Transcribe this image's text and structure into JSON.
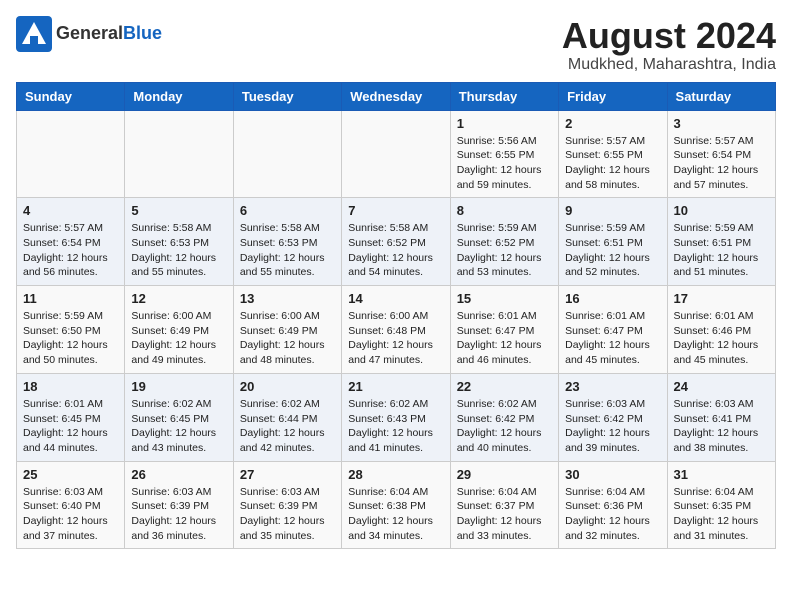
{
  "header": {
    "logo_general": "General",
    "logo_blue": "Blue",
    "month_year": "August 2024",
    "location": "Mudkhed, Maharashtra, India"
  },
  "weekdays": [
    "Sunday",
    "Monday",
    "Tuesday",
    "Wednesday",
    "Thursday",
    "Friday",
    "Saturday"
  ],
  "weeks": [
    [
      {
        "day": "",
        "content": ""
      },
      {
        "day": "",
        "content": ""
      },
      {
        "day": "",
        "content": ""
      },
      {
        "day": "",
        "content": ""
      },
      {
        "day": "1",
        "content": "Sunrise: 5:56 AM\nSunset: 6:55 PM\nDaylight: 12 hours\nand 59 minutes."
      },
      {
        "day": "2",
        "content": "Sunrise: 5:57 AM\nSunset: 6:55 PM\nDaylight: 12 hours\nand 58 minutes."
      },
      {
        "day": "3",
        "content": "Sunrise: 5:57 AM\nSunset: 6:54 PM\nDaylight: 12 hours\nand 57 minutes."
      }
    ],
    [
      {
        "day": "4",
        "content": "Sunrise: 5:57 AM\nSunset: 6:54 PM\nDaylight: 12 hours\nand 56 minutes."
      },
      {
        "day": "5",
        "content": "Sunrise: 5:58 AM\nSunset: 6:53 PM\nDaylight: 12 hours\nand 55 minutes."
      },
      {
        "day": "6",
        "content": "Sunrise: 5:58 AM\nSunset: 6:53 PM\nDaylight: 12 hours\nand 55 minutes."
      },
      {
        "day": "7",
        "content": "Sunrise: 5:58 AM\nSunset: 6:52 PM\nDaylight: 12 hours\nand 54 minutes."
      },
      {
        "day": "8",
        "content": "Sunrise: 5:59 AM\nSunset: 6:52 PM\nDaylight: 12 hours\nand 53 minutes."
      },
      {
        "day": "9",
        "content": "Sunrise: 5:59 AM\nSunset: 6:51 PM\nDaylight: 12 hours\nand 52 minutes."
      },
      {
        "day": "10",
        "content": "Sunrise: 5:59 AM\nSunset: 6:51 PM\nDaylight: 12 hours\nand 51 minutes."
      }
    ],
    [
      {
        "day": "11",
        "content": "Sunrise: 5:59 AM\nSunset: 6:50 PM\nDaylight: 12 hours\nand 50 minutes."
      },
      {
        "day": "12",
        "content": "Sunrise: 6:00 AM\nSunset: 6:49 PM\nDaylight: 12 hours\nand 49 minutes."
      },
      {
        "day": "13",
        "content": "Sunrise: 6:00 AM\nSunset: 6:49 PM\nDaylight: 12 hours\nand 48 minutes."
      },
      {
        "day": "14",
        "content": "Sunrise: 6:00 AM\nSunset: 6:48 PM\nDaylight: 12 hours\nand 47 minutes."
      },
      {
        "day": "15",
        "content": "Sunrise: 6:01 AM\nSunset: 6:47 PM\nDaylight: 12 hours\nand 46 minutes."
      },
      {
        "day": "16",
        "content": "Sunrise: 6:01 AM\nSunset: 6:47 PM\nDaylight: 12 hours\nand 45 minutes."
      },
      {
        "day": "17",
        "content": "Sunrise: 6:01 AM\nSunset: 6:46 PM\nDaylight: 12 hours\nand 45 minutes."
      }
    ],
    [
      {
        "day": "18",
        "content": "Sunrise: 6:01 AM\nSunset: 6:45 PM\nDaylight: 12 hours\nand 44 minutes."
      },
      {
        "day": "19",
        "content": "Sunrise: 6:02 AM\nSunset: 6:45 PM\nDaylight: 12 hours\nand 43 minutes."
      },
      {
        "day": "20",
        "content": "Sunrise: 6:02 AM\nSunset: 6:44 PM\nDaylight: 12 hours\nand 42 minutes."
      },
      {
        "day": "21",
        "content": "Sunrise: 6:02 AM\nSunset: 6:43 PM\nDaylight: 12 hours\nand 41 minutes."
      },
      {
        "day": "22",
        "content": "Sunrise: 6:02 AM\nSunset: 6:42 PM\nDaylight: 12 hours\nand 40 minutes."
      },
      {
        "day": "23",
        "content": "Sunrise: 6:03 AM\nSunset: 6:42 PM\nDaylight: 12 hours\nand 39 minutes."
      },
      {
        "day": "24",
        "content": "Sunrise: 6:03 AM\nSunset: 6:41 PM\nDaylight: 12 hours\nand 38 minutes."
      }
    ],
    [
      {
        "day": "25",
        "content": "Sunrise: 6:03 AM\nSunset: 6:40 PM\nDaylight: 12 hours\nand 37 minutes."
      },
      {
        "day": "26",
        "content": "Sunrise: 6:03 AM\nSunset: 6:39 PM\nDaylight: 12 hours\nand 36 minutes."
      },
      {
        "day": "27",
        "content": "Sunrise: 6:03 AM\nSunset: 6:39 PM\nDaylight: 12 hours\nand 35 minutes."
      },
      {
        "day": "28",
        "content": "Sunrise: 6:04 AM\nSunset: 6:38 PM\nDaylight: 12 hours\nand 34 minutes."
      },
      {
        "day": "29",
        "content": "Sunrise: 6:04 AM\nSunset: 6:37 PM\nDaylight: 12 hours\nand 33 minutes."
      },
      {
        "day": "30",
        "content": "Sunrise: 6:04 AM\nSunset: 6:36 PM\nDaylight: 12 hours\nand 32 minutes."
      },
      {
        "day": "31",
        "content": "Sunrise: 6:04 AM\nSunset: 6:35 PM\nDaylight: 12 hours\nand 31 minutes."
      }
    ]
  ]
}
